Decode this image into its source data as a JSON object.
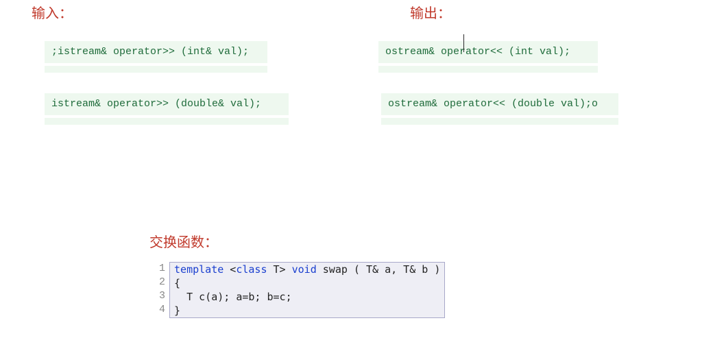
{
  "headings": {
    "input": "输入：",
    "output": "输出：",
    "swap": "交换函数："
  },
  "code": {
    "input_int": ";istream& operator>> (int& val);",
    "input_double": "istream& operator>> (double& val);",
    "output_int": "ostream& operator<< (int val);",
    "output_double": "ostream& operator<< (double val);o"
  },
  "swap": {
    "line_numbers": [
      "1",
      "2",
      "3",
      "4"
    ],
    "kw": {
      "template": "template",
      "class": "class",
      "void": "void"
    },
    "line1_tail": " T> ",
    "line1_swap": "swap ( T& a, T& b )",
    "open_angle": " <",
    "line2": "{",
    "line3": "  T c(a); a=b; b=c;",
    "line4": "}"
  }
}
